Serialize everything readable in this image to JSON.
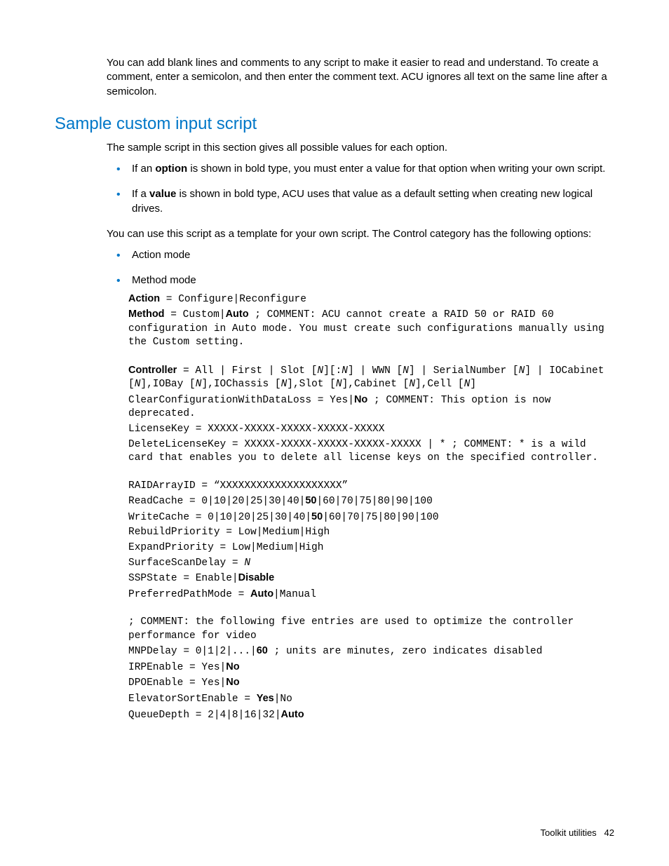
{
  "intro": "You can add blank lines and comments to any script to make it easier to read and understand. To create a comment, enter a semicolon, and then enter the comment text. ACU ignores all text on the same line after a semicolon.",
  "heading": "Sample custom input script",
  "para1": "The sample script in this section gives all possible values for each option.",
  "bullets1": {
    "b1_pre": "If an ",
    "b1_bold": "option",
    "b1_post": " is shown in bold type, you must enter a value for that option when writing your own script.",
    "b2_pre": "If a ",
    "b2_bold": "value",
    "b2_post": " is shown in bold type, ACU uses that value as a default setting when creating new logical drives."
  },
  "para2": "You can use this script as a template for your own script. The Control category has the following options:",
  "bullets2": {
    "b1": "Action mode",
    "b2": "Method mode"
  },
  "code": {
    "action_label": "Action",
    "action_rest": " = Configure|Reconfigure",
    "method_label": "Method",
    "method_mid1": " = Custom|",
    "method_auto": "Auto",
    "method_mid2": " ; COMMENT: ACU cannot create a RAID 50 or RAID 60 configuration in Auto mode. You must create such configurations manually using the Custom setting.",
    "controller_label": "Controller",
    "controller_mid1": " = All | First | Slot [",
    "N": "N",
    "controller_mid2": "][:",
    "controller_mid3": "] | WWN [",
    "controller_mid4": "] | SerialNumber [",
    "controller_mid5": "] | IOCabinet [",
    "controller_mid6": "],IOBay [",
    "controller_mid7": "],IOChassis [",
    "controller_mid8": "],Slot [",
    "controller_mid9": "],Cabinet [",
    "controller_mid10": "],Cell [",
    "controller_end": "]",
    "clearcfg_pre": "ClearConfigurationWithDataLoss = Yes|",
    "clearcfg_no": "No",
    "clearcfg_post": " ; COMMENT: This option is now deprecated.",
    "licensekey": "LicenseKey = XXXXX-XXXXX-XXXXX-XXXXX-XXXXX",
    "deletelicense": "DeleteLicenseKey = XXXXX-XXXXX-XXXXX-XXXXX-XXXXX | * ; COMMENT: * is a wild card that enables you to delete all license keys on the specified controller.",
    "raidarray": "RAIDArrayID = “XXXXXXXXXXXXXXXXXXXX”",
    "readcache_pre": "ReadCache = 0|10|20|25|30|40|",
    "readcache_bold": "50",
    "readcache_post": "|60|70|75|80|90|100",
    "writecache_pre": "WriteCache = 0|10|20|25|30|40|",
    "writecache_bold": "50",
    "writecache_post": "|60|70|75|80|90|100",
    "rebuild": "RebuildPriority = Low|Medium|High",
    "expand": "ExpandPriority = Low|Medium|High",
    "surfacescan_pre": "SurfaceScanDelay = ",
    "sspstate_pre": "SSPState = Enable|",
    "sspstate_bold": "Disable",
    "prefpath_pre": "PreferredPathMode = ",
    "prefpath_bold": "Auto",
    "prefpath_post": "|Manual",
    "comment_video": "; COMMENT: the following five entries are used to optimize the controller performance for video",
    "mnpdelay_pre": "MNPDelay = 0|1|2|...|",
    "mnpdelay_bold": "60",
    "mnpdelay_post": " ; units are minutes, zero indicates disabled",
    "irpenable_pre": "IRPEnable = Yes|",
    "irpenable_bold": "No",
    "dpoenable_pre": "DPOEnable = Yes|",
    "dpoenable_bold": "No",
    "elevator_pre": "ElevatorSortEnable = ",
    "elevator_bold": "Yes",
    "elevator_post": "|No",
    "queuedepth_pre": "QueueDepth = 2|4|8|16|32|",
    "queuedepth_bold": "Auto"
  },
  "footer_label": "Toolkit utilities",
  "footer_page": "42"
}
